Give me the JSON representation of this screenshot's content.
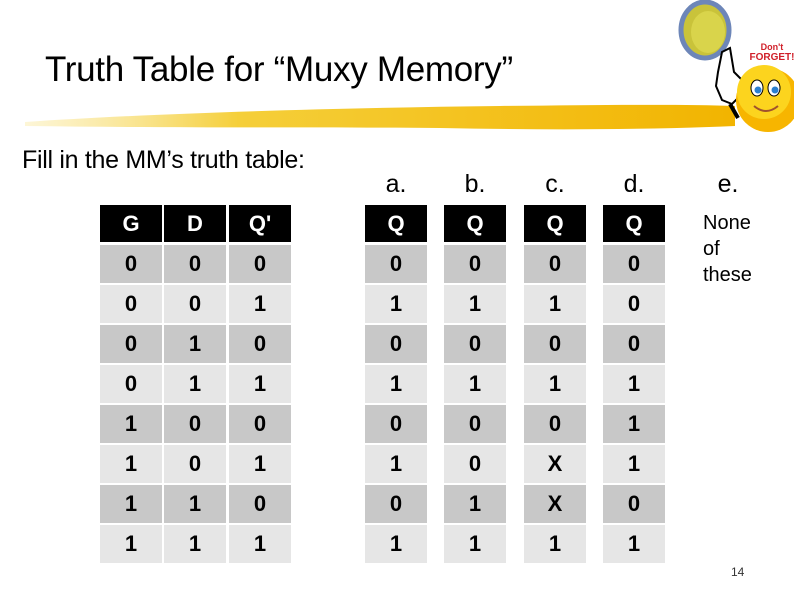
{
  "slide": {
    "title": "Truth Table for “Muxy Memory”",
    "prompt": "Fill in the MM’s truth table:",
    "page_number": "14",
    "clipart": {
      "icon": "dont-forget-smiley-icon",
      "text_line1": "Don't",
      "text_line2": "FORGET!"
    },
    "colors": {
      "header_bg": "#000000",
      "row_dark": "#c8c8c8",
      "row_light": "#e6e6e6",
      "swoosh": "#f5c518"
    }
  },
  "inputs": {
    "columns": [
      {
        "header": "G",
        "values": [
          "0",
          "0",
          "0",
          "0",
          "1",
          "1",
          "1",
          "1"
        ]
      },
      {
        "header": "D",
        "values": [
          "0",
          "0",
          "1",
          "1",
          "0",
          "0",
          "1",
          "1"
        ]
      },
      {
        "header": "Q'",
        "values": [
          "0",
          "1",
          "0",
          "1",
          "0",
          "1",
          "0",
          "1"
        ]
      }
    ]
  },
  "options": [
    {
      "label": "a.",
      "header": "Q",
      "values": [
        "0",
        "1",
        "0",
        "1",
        "0",
        "1",
        "0",
        "1"
      ]
    },
    {
      "label": "b.",
      "header": "Q",
      "values": [
        "0",
        "1",
        "0",
        "1",
        "0",
        "0",
        "1",
        "1"
      ]
    },
    {
      "label": "c.",
      "header": "Q",
      "values": [
        "0",
        "1",
        "0",
        "1",
        "0",
        "X",
        "X",
        "1"
      ]
    },
    {
      "label": "d.",
      "header": "Q",
      "values": [
        "0",
        "0",
        "0",
        "1",
        "1",
        "1",
        "0",
        "1"
      ]
    },
    {
      "label": "e.",
      "text_lines": [
        "None",
        "of",
        "these"
      ]
    }
  ]
}
